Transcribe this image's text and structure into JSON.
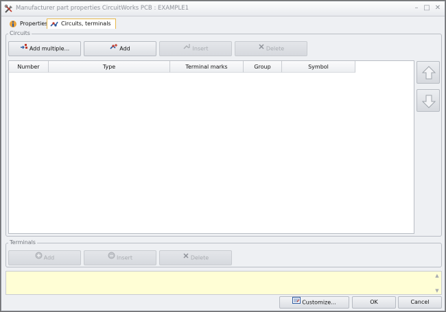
{
  "window": {
    "title": "Manufacturer part properties CircuitWorks PCB : EXAMPLE1",
    "controls": {
      "minimize": "–",
      "maximize": "□",
      "close": "✕"
    }
  },
  "tabs": [
    {
      "label": "Properties",
      "icon": "properties-icon",
      "active": false
    },
    {
      "label": "Circuits, terminals",
      "icon": "circuits-icon",
      "active": true
    }
  ],
  "circuits": {
    "group_label": "Circuits",
    "buttons": {
      "add_multiple": "Add multiple...",
      "add": "Add",
      "insert": "Insert",
      "delete": "Delete"
    },
    "columns": [
      "Number",
      "Type",
      "Terminal marks",
      "Group",
      "Symbol"
    ],
    "rows": []
  },
  "terminals": {
    "group_label": "Terminals",
    "buttons": {
      "add": "Add",
      "insert": "Insert",
      "delete": "Delete"
    }
  },
  "footer": {
    "customize": "Customize...",
    "ok": "OK",
    "cancel": "Cancel"
  },
  "colors": {
    "info_background": "#fffed5",
    "active_tab_border": "#e8b84a"
  }
}
